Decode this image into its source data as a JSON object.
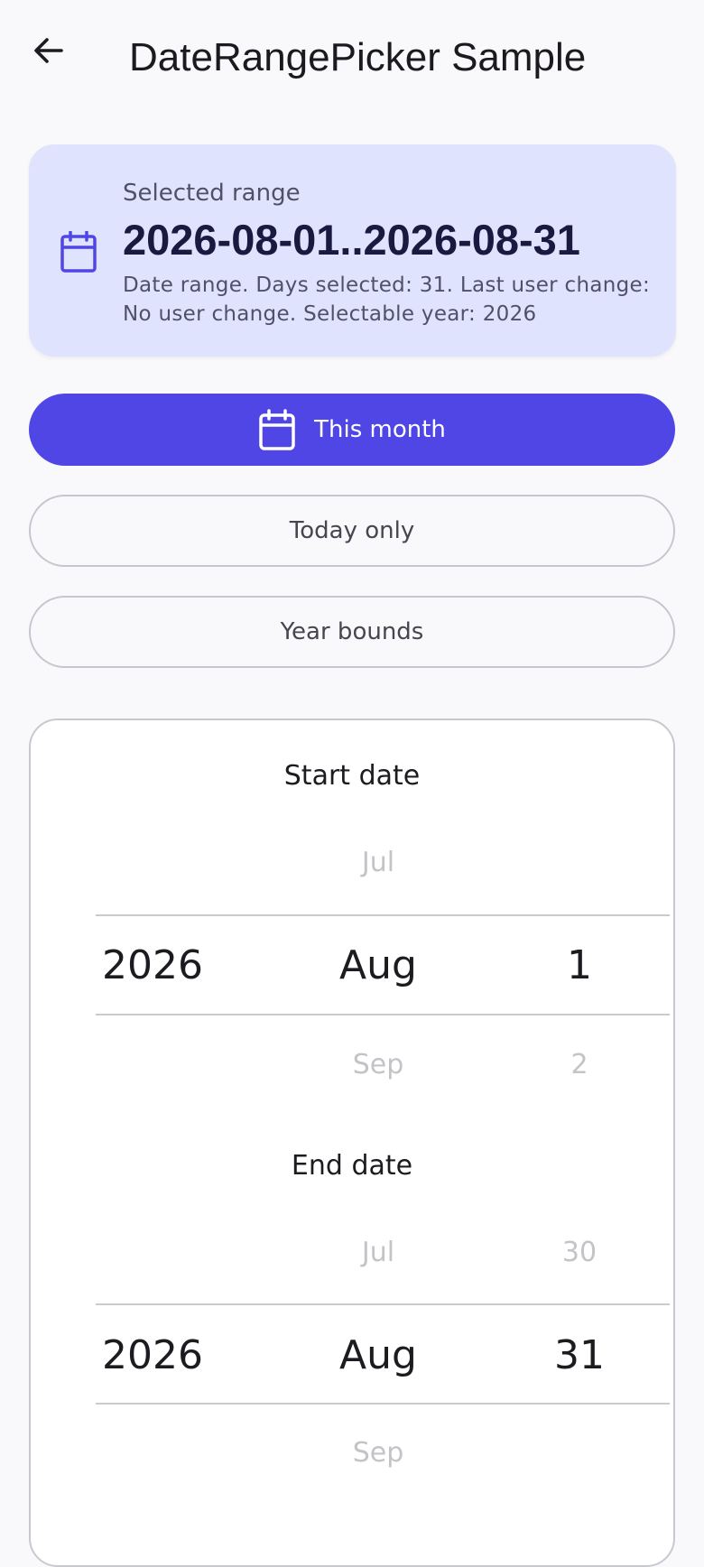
{
  "header": {
    "title": "DateRangePicker Sample"
  },
  "summary": {
    "label": "Selected range",
    "range": "2026-08-01..2026-08-31",
    "description": "Date range. Days selected: 31. Last user change: No user change. Selectable year: 2026"
  },
  "actions": {
    "this_month": "This month",
    "today_only": "Today only",
    "year_bounds": "Year bounds"
  },
  "start_picker": {
    "label": "Start date",
    "month_above": "Jul",
    "year": "2026",
    "month": "Aug",
    "day": "1",
    "month_below": "Sep",
    "day_below": "2"
  },
  "end_picker": {
    "label": "End date",
    "month_above": "Jul",
    "day_above": "30",
    "year": "2026",
    "month": "Aug",
    "day": "31",
    "month_below": "Sep"
  },
  "colors": {
    "primary": "#4f46e5",
    "summary_bg": "#e0e3fd",
    "background": "#f9f9fc"
  },
  "icons": {
    "back": "arrow-left-icon",
    "calendar": "calendar-icon"
  }
}
